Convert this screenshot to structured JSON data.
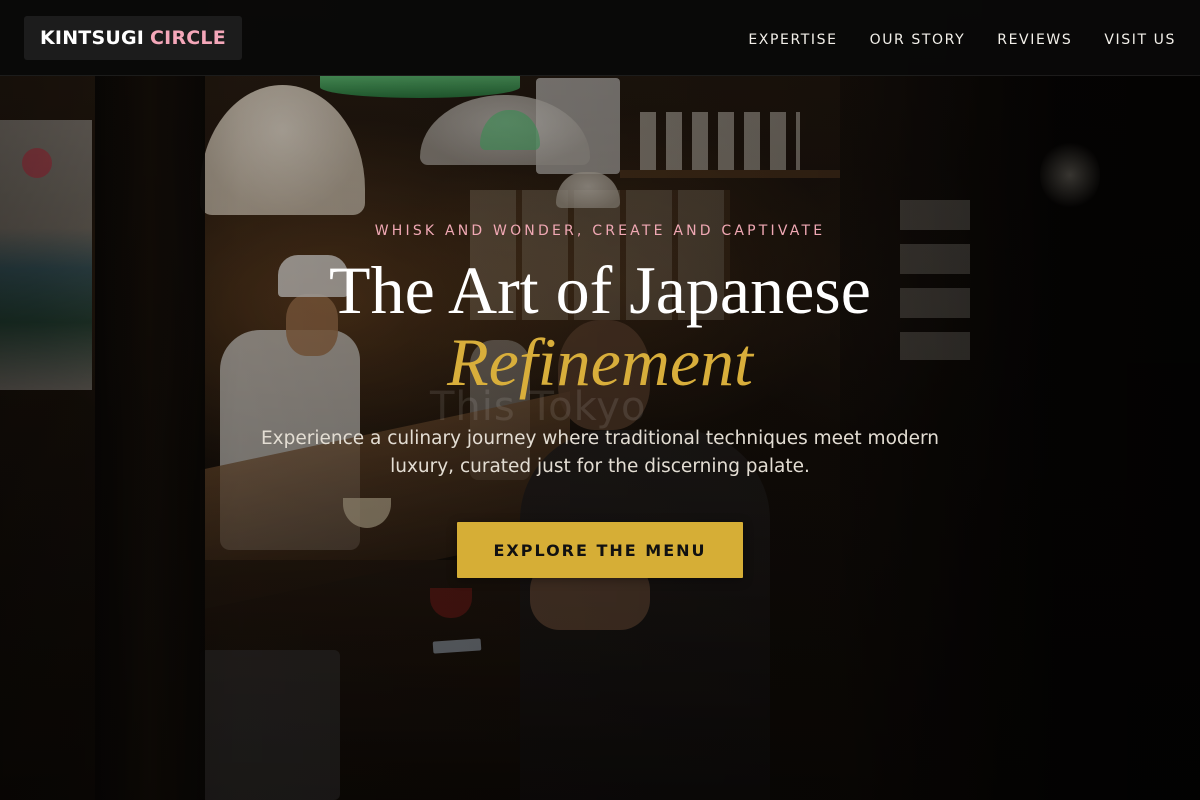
{
  "brand": {
    "name_primary": "KINTSUGI",
    "name_accent": "CIRCLE",
    "accent_color": "#f4a7b9"
  },
  "nav": {
    "items": [
      {
        "label": "EXPERTISE"
      },
      {
        "label": "OUR STORY"
      },
      {
        "label": "REVIEWS"
      },
      {
        "label": "VISIT US"
      }
    ]
  },
  "hero": {
    "eyebrow": "WHISK AND WONDER, CREATE AND CAPTIVATE",
    "title_line1": "The Art of Japanese",
    "title_line2": "Refinement",
    "subtitle": "Experience a culinary journey where traditional techniques meet modern luxury, curated just for the discerning palate.",
    "cta_label": "EXPLORE THE MENU",
    "watermark": "This Tokyo",
    "background_image": "izakaya-counter-photo",
    "colors": {
      "eyebrow": "#f0a8b4",
      "title_accent": "#d8ae3b",
      "cta_background": "#d6ae36"
    }
  }
}
